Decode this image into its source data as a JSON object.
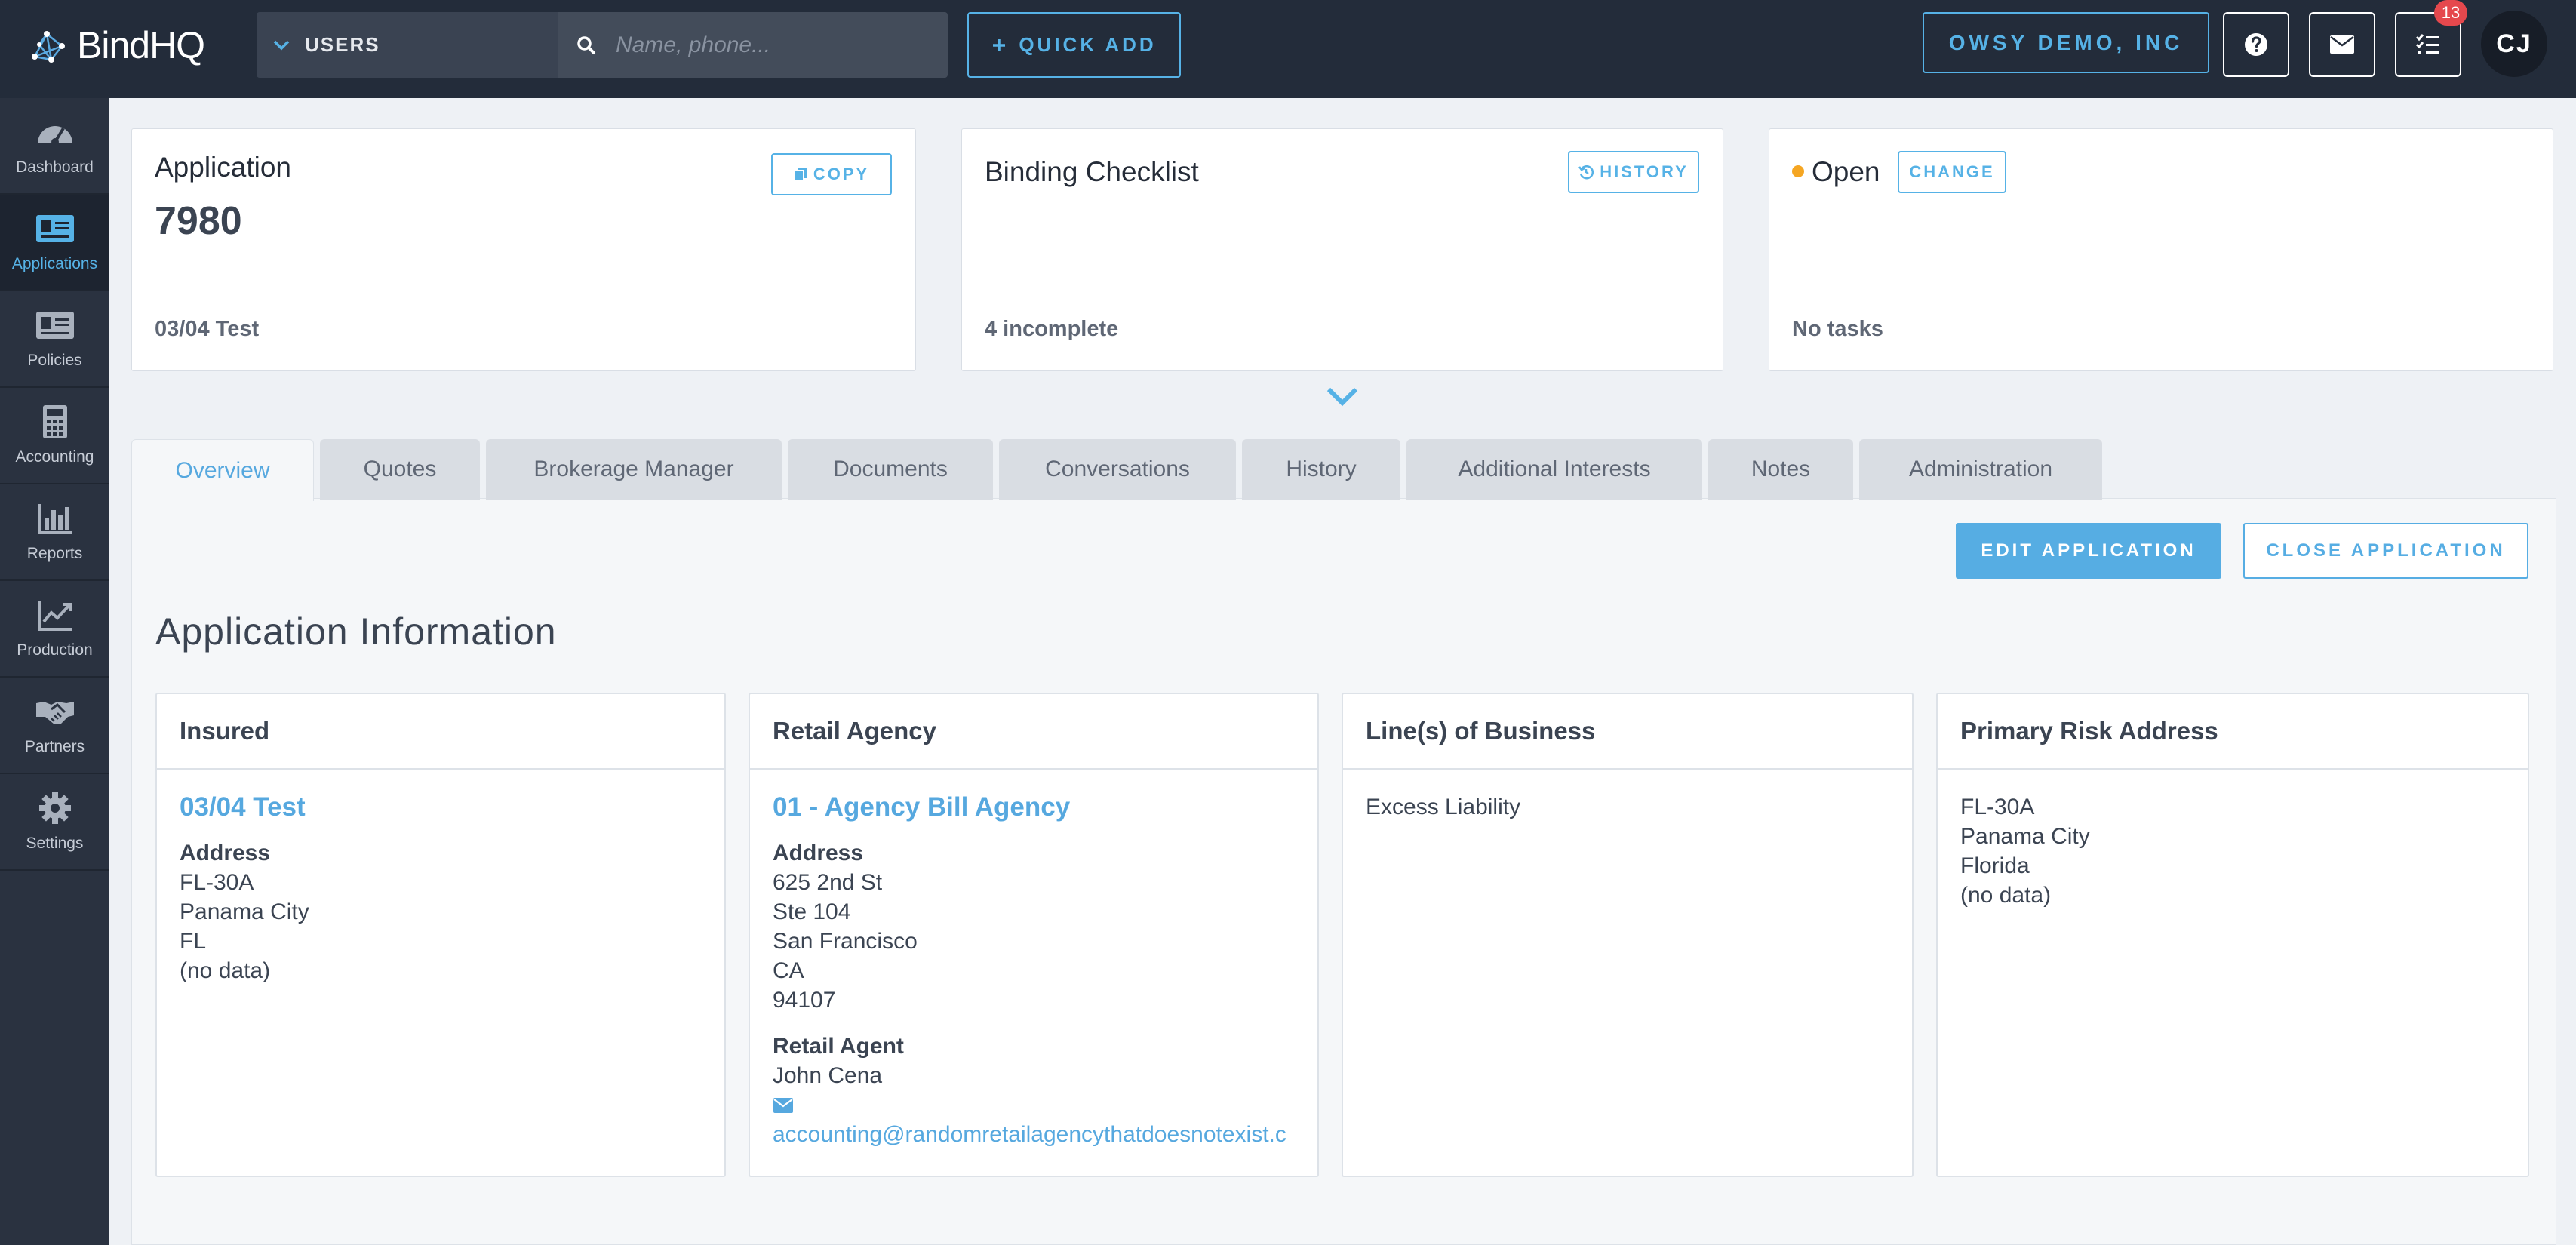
{
  "header": {
    "logo_text": "BindHQ",
    "scope_label": "USERS",
    "search_placeholder": "Name, phone...",
    "quick_add_label": "QUICK ADD",
    "company_label": "OWSY DEMO, INC",
    "tasks_badge": "13",
    "avatar_initials": "CJ",
    "icons": [
      "help-icon",
      "mail-icon",
      "tasks-icon"
    ]
  },
  "sidebar": {
    "items": [
      {
        "label": "Dashboard",
        "icon": "gauge-icon"
      },
      {
        "label": "Applications",
        "icon": "application-card-icon"
      },
      {
        "label": "Policies",
        "icon": "policy-card-icon"
      },
      {
        "label": "Accounting",
        "icon": "calculator-icon"
      },
      {
        "label": "Reports",
        "icon": "bar-chart-icon"
      },
      {
        "label": "Production",
        "icon": "line-chart-icon"
      },
      {
        "label": "Partners",
        "icon": "handshake-icon"
      },
      {
        "label": "Settings",
        "icon": "gear-icon"
      }
    ],
    "active": "Applications"
  },
  "summary": {
    "application": {
      "title": "Application",
      "number": "7980",
      "footer": "03/04 Test",
      "button": "COPY"
    },
    "checklist": {
      "title": "Binding Checklist",
      "footer": "4 incomplete",
      "button": "HISTORY"
    },
    "status": {
      "title": "Open",
      "footer": "No tasks",
      "button": "CHANGE",
      "dot_color": "#f5a623"
    }
  },
  "tabs": [
    "Overview",
    "Quotes",
    "Brokerage Manager",
    "Documents",
    "Conversations",
    "History",
    "Additional Interests",
    "Notes",
    "Administration"
  ],
  "active_tab": "Overview",
  "actions": {
    "edit": "EDIT APPLICATION",
    "close": "CLOSE APPLICATION"
  },
  "section_title": "Application Information",
  "panels": {
    "insured": {
      "heading": "Insured",
      "name": "03/04 Test",
      "address_label": "Address",
      "address_lines": [
        "FL-30A",
        "Panama City",
        "FL",
        "(no data)"
      ]
    },
    "agency": {
      "heading": "Retail Agency",
      "name": "01 - Agency Bill Agency",
      "address_label": "Address",
      "address_lines": [
        "625 2nd St",
        "Ste 104",
        "San Francisco",
        "CA",
        "94107"
      ],
      "agent_label": "Retail Agent",
      "agent_name": "John Cena",
      "agent_email": "accounting@randomretailagencythatdoesnotexist.c"
    },
    "lob": {
      "heading": "Line(s) of Business",
      "value": "Excess Liability"
    },
    "risk": {
      "heading": "Primary Risk Address",
      "address_lines": [
        "FL-30A",
        "Panama City",
        "Florida",
        "(no data)"
      ]
    }
  },
  "colors": {
    "accent": "#56b2e6",
    "topbar": "#232c3a",
    "sidebar": "#2a3240",
    "badge": "#e5484d"
  }
}
